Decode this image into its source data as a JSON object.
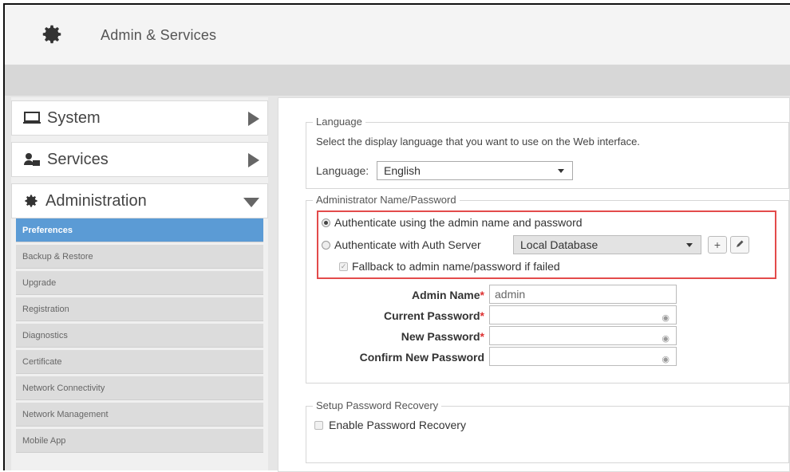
{
  "header": {
    "title": "Admin & Services",
    "icon": "gear-icon"
  },
  "sidebar": {
    "sections": [
      {
        "label": "System",
        "icon": "monitor-icon",
        "state": "collapsed"
      },
      {
        "label": "Services",
        "icon": "services-icon",
        "state": "collapsed"
      },
      {
        "label": "Administration",
        "icon": "gear-icon",
        "state": "expanded"
      }
    ],
    "items": [
      {
        "label": "Preferences",
        "active": true
      },
      {
        "label": "Backup & Restore"
      },
      {
        "label": "Upgrade"
      },
      {
        "label": "Registration"
      },
      {
        "label": "Diagnostics"
      },
      {
        "label": "Certificate"
      },
      {
        "label": "Network Connectivity"
      },
      {
        "label": "Network Management"
      },
      {
        "label": "Mobile App"
      }
    ]
  },
  "main": {
    "language": {
      "legend": "Language",
      "description": "Select the display language that you want to use on the Web interface.",
      "label": "Language:",
      "value": "English"
    },
    "admin": {
      "legend": "Administrator Name/Password",
      "radio_admin": "Authenticate using the admin name and password",
      "radio_server": "Authenticate with Auth Server",
      "server_value": "Local Database",
      "fallback_label": "Fallback to admin name/password if failed",
      "admin_name_label": "Admin Name",
      "admin_name_value": "admin",
      "current_password_label": "Current Password",
      "new_password_label": "New Password",
      "confirm_password_label": "Confirm New Password",
      "required_mark": "*"
    },
    "recovery": {
      "legend": "Setup Password Recovery",
      "enable_label": "Enable Password Recovery"
    }
  },
  "colors": {
    "active_item": "#5b9bd5",
    "highlight_border": "#e34b4b"
  }
}
